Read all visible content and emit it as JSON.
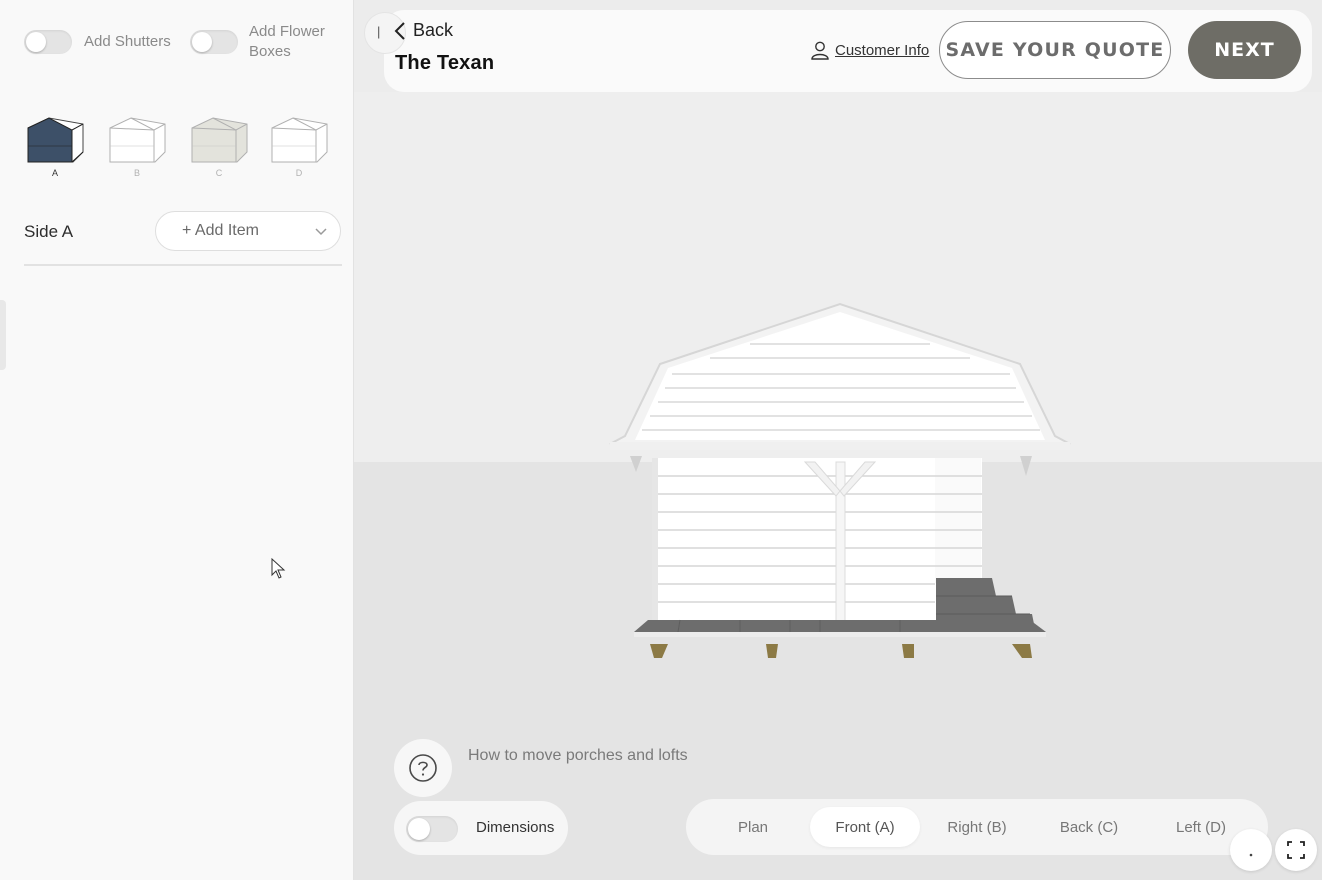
{
  "left_panel": {
    "options": [
      {
        "label": "Add Shutters",
        "on": false
      },
      {
        "label": "Add Flower\nBoxes",
        "on": false
      }
    ],
    "sides": [
      {
        "label": "A",
        "active": true
      },
      {
        "label": "B",
        "active": false
      },
      {
        "label": "C",
        "active": false
      },
      {
        "label": "D",
        "active": false
      }
    ],
    "side_title": "Side A",
    "add_item_label": "+ Add Item"
  },
  "header": {
    "back_label": "Back",
    "product_name": "The Texan",
    "customer_info_label": "Customer Info",
    "save_quote_label": "SAVE YOUR QUOTE",
    "next_label": "NEXT"
  },
  "viewport": {
    "help_text": "How to move porches and lofts",
    "dimensions_label": "Dimensions",
    "dimensions_on": false,
    "views": [
      "Plan",
      "Front (A)",
      "Right (B)",
      "Back (C)",
      "Left (D)"
    ],
    "active_view": "Front (A)"
  },
  "colors": {
    "accent_dark": "#6e6d66",
    "active_side": "#3d5068",
    "deck": "#6d6d6d",
    "post_wood": "#8c7a45"
  },
  "icons": {
    "back": "chevron-left-icon",
    "customer": "user-icon",
    "help": "question-circle-icon",
    "expand": "fullscreen-icon",
    "dropdown": "chevron-down-icon"
  }
}
